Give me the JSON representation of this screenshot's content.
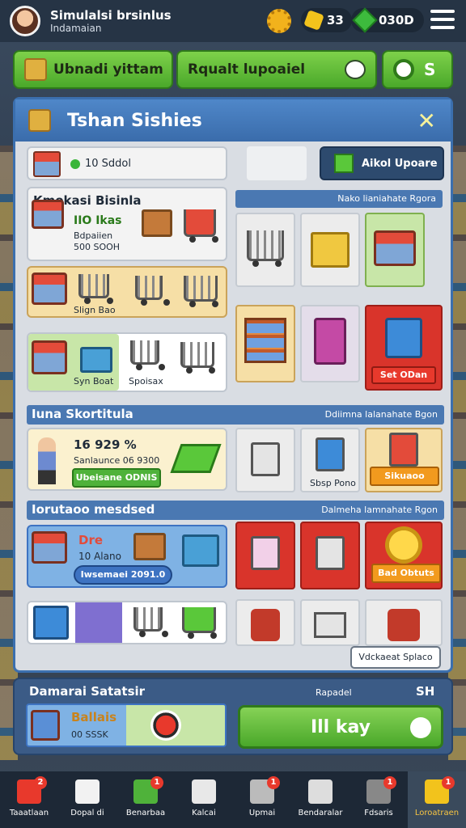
{
  "header": {
    "title": "Simulalsi brsinlus",
    "subtitle": "Indamaian",
    "keys": "33",
    "gems": "030D"
  },
  "actions": {
    "left_button": "Ubnadi yittam",
    "right_button": "Rqualt lupoaiel",
    "third_button": "S"
  },
  "panel": {
    "title": "Tshan Sishies",
    "stock_label": "10 Sddol",
    "upgrade_button": "Aikol Upoare",
    "section1": {
      "title": "Kmokasi Bisinla",
      "hint": "Nako lianiahate Rgora",
      "price_line1": "IIO Ikas",
      "price_line2": "Bdpaiien",
      "price_line3": "500 SOOH",
      "tag_cream": "Slign Bao",
      "tag_green": "Syn Boat",
      "tag_sale": "Spoisax",
      "red_tag": "Set ODan"
    },
    "section2": {
      "title": "Iuna Skortitula",
      "hint": "Ddiimna lalanahate Bgon",
      "percent": "16 929 %",
      "subline": "Sanlaunce 06 9300",
      "green_button": "Ubeisane ODNIS",
      "tile_tag": "Sbsp Pono",
      "orange_tag": "Sikuaoo"
    },
    "section3": {
      "title": "Iorutaoo mesdsed",
      "hint": "Dalmeha lamnahate Rgon",
      "price_a": "Dre",
      "price_b": "10 Alano",
      "blue_button": "Iwsemaei 2091.0",
      "orange_tag": "Bad Obtuts"
    },
    "footer_button": "Vdckaeat Splaco"
  },
  "bottom": {
    "title": "Damarai Satatsir",
    "sub_label": "Rapadel",
    "score": "SH",
    "card_name": "Ballais",
    "card_value": "00 SSSK",
    "play_button": "Ill kay"
  },
  "nav": [
    {
      "label": "Taaatlaan",
      "badge": "2",
      "color": "#e8392c"
    },
    {
      "label": "Dopal di",
      "badge": "",
      "color": "#f2f2f2"
    },
    {
      "label": "Benarbaa",
      "badge": "1",
      "color": "#4fb23a"
    },
    {
      "label": "Kalcai",
      "badge": "",
      "color": "#e8e8e8"
    },
    {
      "label": "Upmai",
      "badge": "1",
      "color": "#bbbbbb"
    },
    {
      "label": "Bendaralar",
      "badge": "",
      "color": "#dddddd"
    },
    {
      "label": "Fdsaris",
      "badge": "1",
      "color": "#888888"
    },
    {
      "label": "Loroatraen",
      "badge": "1",
      "color": "#f2c31c"
    }
  ]
}
